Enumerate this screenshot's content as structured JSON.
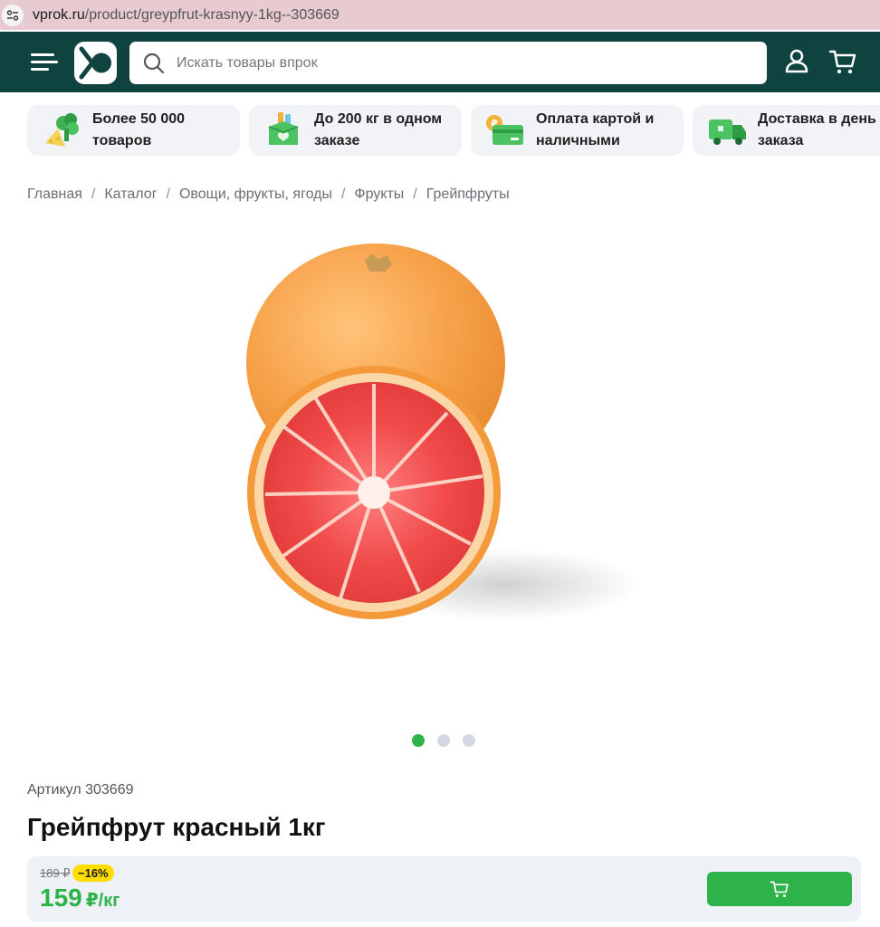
{
  "browser": {
    "url_host": "vprok.ru",
    "url_path": "/product/greypfrut-krasnyy-1kg--303669"
  },
  "header": {
    "search_placeholder": "Искать товары впрок",
    "colors": {
      "background": "#0e4340"
    }
  },
  "features": [
    {
      "line1": "Более 50 000",
      "line2": "товаров",
      "icon": "vegetables-icon"
    },
    {
      "line1": "До 200 кг в одном",
      "line2": "заказе",
      "icon": "grocery-box-icon"
    },
    {
      "line1": "Оплата картой и",
      "line2": "наличными",
      "icon": "payment-card-icon"
    },
    {
      "line1": "Доставка в день",
      "line2": "заказа",
      "icon": "delivery-truck-icon"
    }
  ],
  "breadcrumb": [
    "Главная",
    "Каталог",
    "Овощи, фрукты, ягоды",
    "Фрукты",
    "Грейпфруты"
  ],
  "gallery": {
    "count": 3,
    "active_index": 0
  },
  "product": {
    "sku": "Артикул 303669",
    "title": "Грейпфрут красный 1кг",
    "old_price": "189 ₽",
    "discount": "−16%",
    "price": "159",
    "price_unit": "₽/кг"
  },
  "colors": {
    "accent_green": "#2eb34a",
    "discount_yellow": "#ffdd00"
  }
}
